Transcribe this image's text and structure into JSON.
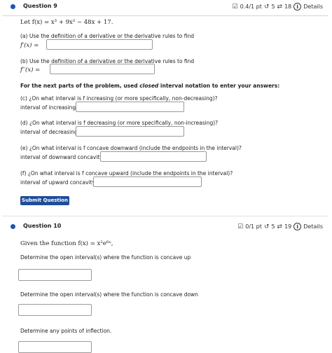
{
  "q9": {
    "title": "Question 9",
    "score": "0.4/1 pt",
    "retries": "5",
    "attempts": "18",
    "details": "Details",
    "function_def": "Let f(x) = x³ + 9x² − 48x + 17.",
    "part_a_prompt": "(a)  Use the definition of a derivative or the derivative rules to find",
    "part_a_label": "f′(x) =",
    "part_b_prompt": "(b)  Use the definition of a derivative or the derivative rules to find",
    "part_b_label": "f′′(x) =",
    "instructions_pre": "For the next parts of the problem, used ",
    "instructions_em": "closed",
    "instructions_post": " interval notation to enter your answers:",
    "part_c_prompt": "(c)  ¿On what interval is f increasing (or more specifically, non-decreasing)?",
    "part_c_label": "interval of increasing =",
    "part_d_prompt": "(d)  ¿On what interval is f decreasing (or more specifically, non-increasing)?",
    "part_d_label": "interval of decreasing =",
    "part_e_prompt": "(e)  ¿On what interval is f concave downward (include the endpoints in the interval)?",
    "part_e_label": "interval of downward concavity =",
    "part_f_prompt": "(f)  ¿On what interval is f concave upward (include the endpoints in the interval)?",
    "part_f_label": "interval of upward concavity =",
    "submit_label": "Submit Question"
  },
  "q10": {
    "title": "Question 10",
    "score": "0/1 pt",
    "retries": "5",
    "attempts": "19",
    "details": "Details",
    "function_def": "Given the function f(x) = x²e⁶ˣ,",
    "prompt_up": "Determine the open interval(s) where the function is concave up",
    "prompt_down": "Determine the open interval(s) where the function is concave down",
    "prompt_inflection": "Determine any points of inflection."
  },
  "icons": {
    "score": "edit-check-icon",
    "retry": "retry-icon",
    "attempts": "attempts-icon",
    "info": "info-icon"
  },
  "colors": {
    "accent": "#1b56b0",
    "button": "#1e4d9a"
  }
}
